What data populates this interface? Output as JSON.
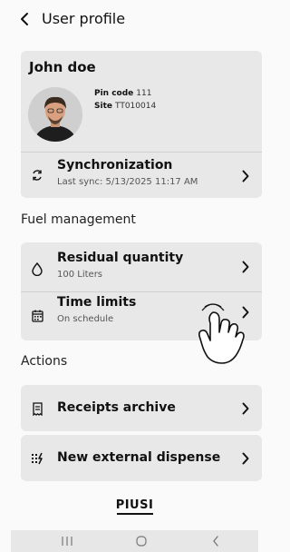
{
  "header": {
    "title": "User profile"
  },
  "profile": {
    "name": "John doe",
    "pin_label": "Pin code",
    "pin_value": "111",
    "site_label": "Site",
    "site_value": "TT010014",
    "sync": {
      "title": "Synchronization",
      "subtitle": "Last sync: 5/13/2025 11:17 AM"
    }
  },
  "fuel": {
    "heading": "Fuel management",
    "residual": {
      "title": "Residual quantity",
      "subtitle": "100 Liters"
    },
    "time_limits": {
      "title": "Time limits",
      "subtitle": "On schedule"
    }
  },
  "actions": {
    "heading": "Actions",
    "receipts": {
      "title": "Receipts archive"
    },
    "dispense": {
      "title": "New external dispense"
    }
  },
  "brand": {
    "logo_text": "PIUSI"
  },
  "colors": {
    "card_bg": "#e8e8e8",
    "page_bg": "#fafafa",
    "text": "#111111"
  }
}
